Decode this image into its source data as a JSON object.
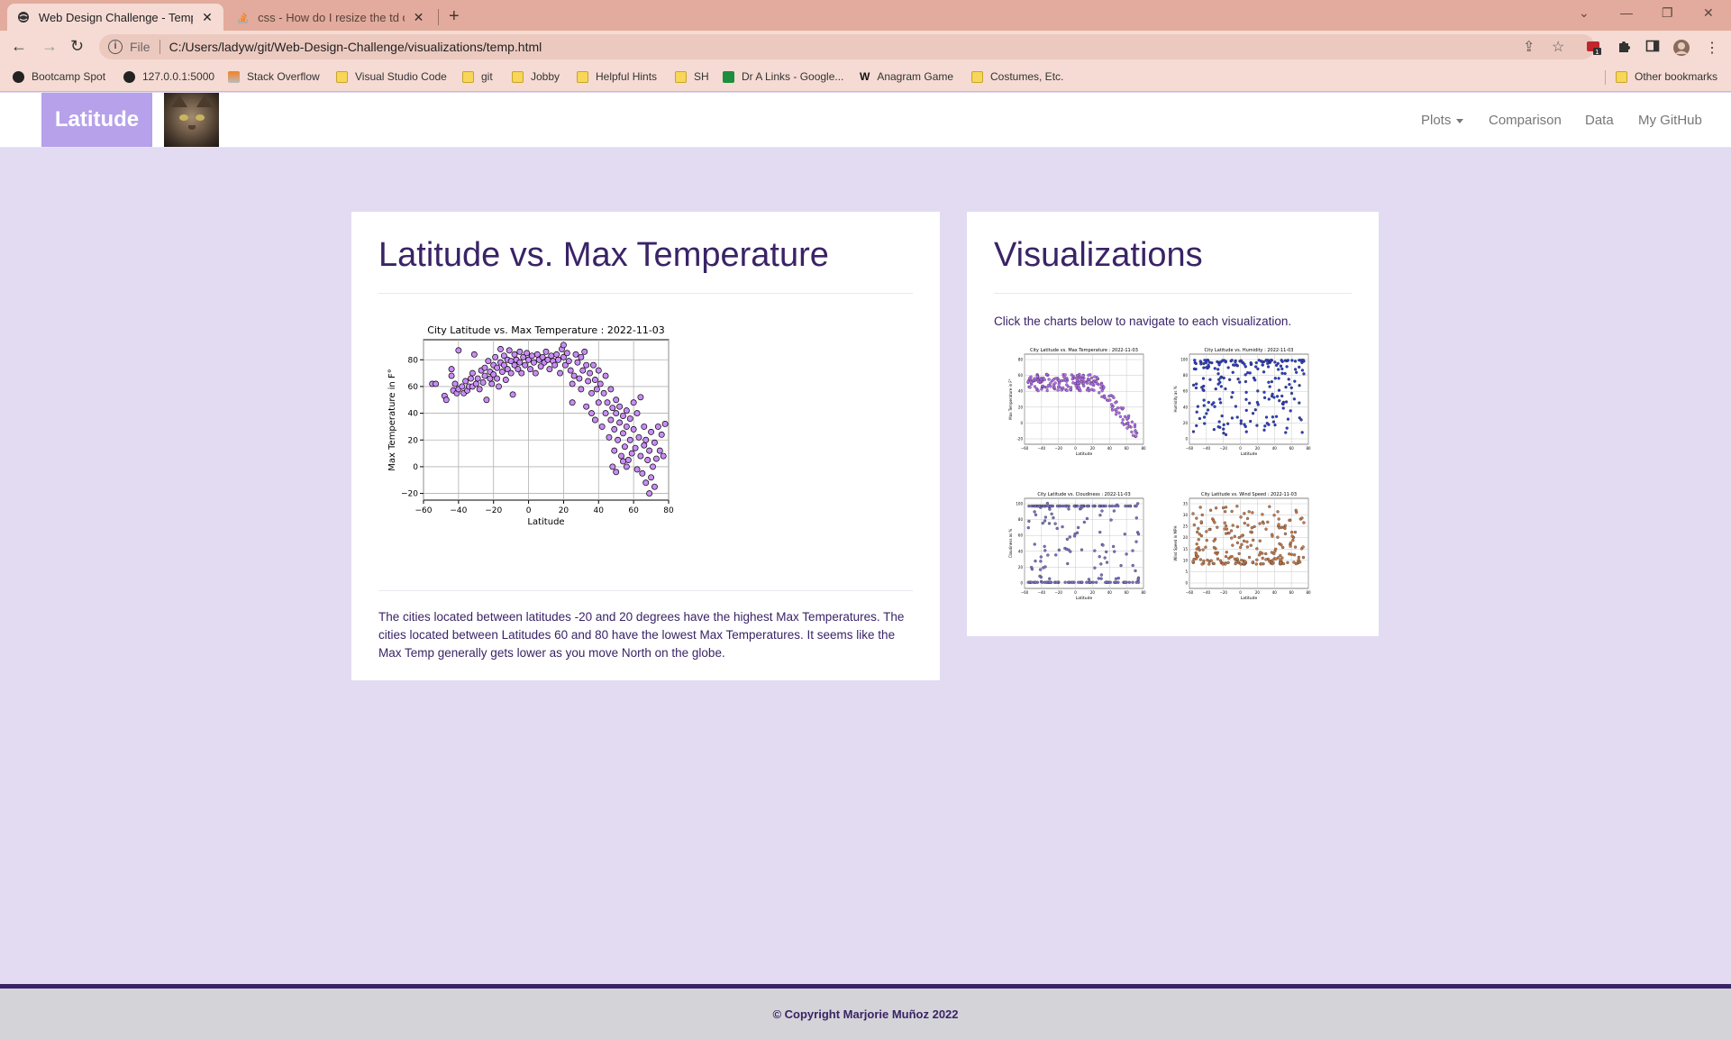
{
  "browser": {
    "tabs": [
      {
        "title": "Web Design Challenge - Tempera",
        "active": true
      },
      {
        "title": "css - How do I resize the td of a t",
        "active": false
      }
    ],
    "address": {
      "scheme": "File",
      "url": "C:/Users/ladyw/git/Web-Design-Challenge/visualizations/temp.html"
    },
    "extension_badge": "1",
    "bookmarks": [
      {
        "label": "Bootcamp Spot",
        "icon": "globe-icon"
      },
      {
        "label": "127.0.0.1:5000",
        "icon": "globe-icon"
      },
      {
        "label": "Stack Overflow",
        "icon": "stackoverflow-icon"
      },
      {
        "label": "Visual Studio Code",
        "icon": "folder-icon"
      },
      {
        "label": "git",
        "icon": "folder-icon"
      },
      {
        "label": "Jobby",
        "icon": "folder-icon"
      },
      {
        "label": "Helpful Hints",
        "icon": "folder-icon"
      },
      {
        "label": "SH",
        "icon": "folder-icon"
      },
      {
        "label": "Dr A Links - Google...",
        "icon": "sheets-icon"
      },
      {
        "label": "Anagram Game",
        "icon": "w-icon"
      },
      {
        "label": "Costumes, Etc.",
        "icon": "folder-icon"
      }
    ],
    "other_bookmarks": "Other bookmarks"
  },
  "navbar": {
    "brand": "Latitude",
    "links": [
      "Plots",
      "Comparison",
      "Data",
      "My GitHub"
    ]
  },
  "main": {
    "title": "Latitude vs. Max Temperature",
    "description": "The cities located between latitudes -20 and 20 degrees have the highest Max Temperatures. The cities located between Latitudes 60 and 80 have the lowest Max Temperatures. It seems like the Max Temp generally gets lower as you move North on the globe."
  },
  "side": {
    "title": "Visualizations",
    "instruction": "Click the charts below to navigate to each visualization.",
    "thumbnails": [
      {
        "title": "City Latitude vs. Max Temperature : 2022-11-03",
        "xlabel": "Latitude",
        "ylabel": "Max Temperature in F°",
        "color": "#b46cf0",
        "yticks": [
          "80",
          "60",
          "40",
          "20",
          "0",
          "-20"
        ]
      },
      {
        "title": "City Latitude vs. Humidity : 2022-11-03",
        "xlabel": "Latitude",
        "ylabel": "Humidity as %",
        "color": "#2d3fc8",
        "yticks": [
          "100",
          "80",
          "60",
          "40",
          "20",
          "0"
        ]
      },
      {
        "title": "City Latitude vs. Cloudiness : 2022-11-03",
        "xlabel": "Latitude",
        "ylabel": "Cloudiness as %",
        "color": "#7a72c8",
        "yticks": [
          "100",
          "80",
          "60",
          "40",
          "20",
          "0"
        ]
      },
      {
        "title": "City Latitude vs. Wind Speed : 2022-11-03",
        "xlabel": "Latitude",
        "ylabel": "Wind Speed in MPH",
        "color": "#c87a4a",
        "yticks": [
          "35",
          "30",
          "25",
          "20",
          "15",
          "10",
          "5",
          "0"
        ]
      }
    ],
    "thumb_xticks": [
      "−60",
      "−40",
      "−20",
      "0",
      "20",
      "40",
      "60",
      "80"
    ]
  },
  "chart_data": {
    "type": "scatter",
    "title": "City Latitude vs. Max Temperature : 2022-11-03",
    "xlabel": "Latitude",
    "ylabel": "Max Temperature in F°",
    "xlim": [
      -60,
      80
    ],
    "ylim": [
      -25,
      95
    ],
    "xticks": [
      "−60",
      "−40",
      "−20",
      "0",
      "20",
      "40",
      "60",
      "80"
    ],
    "yticks": [
      "80",
      "60",
      "40",
      "20",
      "0",
      "−20"
    ],
    "grid": true,
    "marker_color": "#c98cf5",
    "points": [
      [
        -55,
        62
      ],
      [
        -53,
        62
      ],
      [
        -48,
        53
      ],
      [
        -47,
        50
      ],
      [
        -44,
        73
      ],
      [
        -44,
        68
      ],
      [
        -43,
        57
      ],
      [
        -42,
        62
      ],
      [
        -41,
        55
      ],
      [
        -40,
        87
      ],
      [
        -40,
        58
      ],
      [
        -38,
        60
      ],
      [
        -37,
        55
      ],
      [
        -36,
        64
      ],
      [
        -35,
        57
      ],
      [
        -34,
        60
      ],
      [
        -33,
        66
      ],
      [
        -32,
        70
      ],
      [
        -32,
        60
      ],
      [
        -31,
        84
      ],
      [
        -30,
        62
      ],
      [
        -29,
        66
      ],
      [
        -28,
        58
      ],
      [
        -27,
        72
      ],
      [
        -26,
        63
      ],
      [
        -25,
        74
      ],
      [
        -25,
        68
      ],
      [
        -24,
        50
      ],
      [
        -23,
        79
      ],
      [
        -22,
        71
      ],
      [
        -22,
        66
      ],
      [
        -21,
        62
      ],
      [
        -20,
        76
      ],
      [
        -20,
        69
      ],
      [
        -19,
        82
      ],
      [
        -18,
        74
      ],
      [
        -18,
        66
      ],
      [
        -17,
        60
      ],
      [
        -16,
        88
      ],
      [
        -16,
        78
      ],
      [
        -15,
        71
      ],
      [
        -14,
        83
      ],
      [
        -14,
        76
      ],
      [
        -13,
        65
      ],
      [
        -12,
        80
      ],
      [
        -12,
        73
      ],
      [
        -11,
        87
      ],
      [
        -10,
        79
      ],
      [
        -10,
        70
      ],
      [
        -9,
        54
      ],
      [
        -8,
        84
      ],
      [
        -8,
        76
      ],
      [
        -7,
        80
      ],
      [
        -6,
        73
      ],
      [
        -5,
        86
      ],
      [
        -5,
        78
      ],
      [
        -4,
        70
      ],
      [
        -3,
        82
      ],
      [
        -2,
        76
      ],
      [
        -1,
        85
      ],
      [
        0,
        80
      ],
      [
        1,
        73
      ],
      [
        2,
        83
      ],
      [
        3,
        78
      ],
      [
        4,
        70
      ],
      [
        5,
        84
      ],
      [
        6,
        80
      ],
      [
        7,
        75
      ],
      [
        8,
        82
      ],
      [
        9,
        78
      ],
      [
        10,
        86
      ],
      [
        11,
        80
      ],
      [
        12,
        73
      ],
      [
        13,
        83
      ],
      [
        14,
        79
      ],
      [
        15,
        76
      ],
      [
        16,
        84
      ],
      [
        17,
        80
      ],
      [
        18,
        70
      ],
      [
        19,
        88
      ],
      [
        20,
        91
      ],
      [
        20,
        82
      ],
      [
        21,
        76
      ],
      [
        22,
        85
      ],
      [
        23,
        79
      ],
      [
        24,
        72
      ],
      [
        25,
        62
      ],
      [
        25,
        48
      ],
      [
        26,
        68
      ],
      [
        27,
        84
      ],
      [
        28,
        78
      ],
      [
        29,
        66
      ],
      [
        30,
        82
      ],
      [
        30,
        58
      ],
      [
        31,
        72
      ],
      [
        32,
        86
      ],
      [
        33,
        76
      ],
      [
        33,
        45
      ],
      [
        34,
        64
      ],
      [
        35,
        70
      ],
      [
        36,
        55
      ],
      [
        36,
        40
      ],
      [
        37,
        76
      ],
      [
        38,
        65
      ],
      [
        38,
        35
      ],
      [
        39,
        58
      ],
      [
        40,
        72
      ],
      [
        40,
        48
      ],
      [
        41,
        62
      ],
      [
        42,
        30
      ],
      [
        43,
        55
      ],
      [
        44,
        68
      ],
      [
        44,
        40
      ],
      [
        45,
        48
      ],
      [
        46,
        22
      ],
      [
        47,
        35
      ],
      [
        47,
        58
      ],
      [
        48,
        44
      ],
      [
        49,
        28
      ],
      [
        49,
        12
      ],
      [
        50,
        40
      ],
      [
        50,
        50
      ],
      [
        51,
        20
      ],
      [
        52,
        33
      ],
      [
        52,
        45
      ],
      [
        53,
        8
      ],
      [
        54,
        25
      ],
      [
        54,
        38
      ],
      [
        55,
        15
      ],
      [
        56,
        42
      ],
      [
        56,
        30
      ],
      [
        57,
        5
      ],
      [
        58,
        20
      ],
      [
        58,
        36
      ],
      [
        59,
        10
      ],
      [
        60,
        48
      ],
      [
        60,
        28
      ],
      [
        61,
        14
      ],
      [
        62,
        -2
      ],
      [
        62,
        40
      ],
      [
        63,
        22
      ],
      [
        64,
        8
      ],
      [
        64,
        52
      ],
      [
        65,
        -5
      ],
      [
        66,
        16
      ],
      [
        66,
        30
      ],
      [
        67,
        -12
      ],
      [
        67,
        20
      ],
      [
        68,
        5
      ],
      [
        69,
        -20
      ],
      [
        69,
        12
      ],
      [
        70,
        26
      ],
      [
        70,
        -8
      ],
      [
        71,
        0
      ],
      [
        72,
        18
      ],
      [
        72,
        -15
      ],
      [
        73,
        6
      ],
      [
        74,
        30
      ],
      [
        75,
        12
      ],
      [
        76,
        24
      ],
      [
        77,
        8
      ],
      [
        78,
        32
      ],
      [
        56,
        0
      ],
      [
        54,
        4
      ],
      [
        48,
        0
      ],
      [
        50,
        -4
      ]
    ]
  }
}
